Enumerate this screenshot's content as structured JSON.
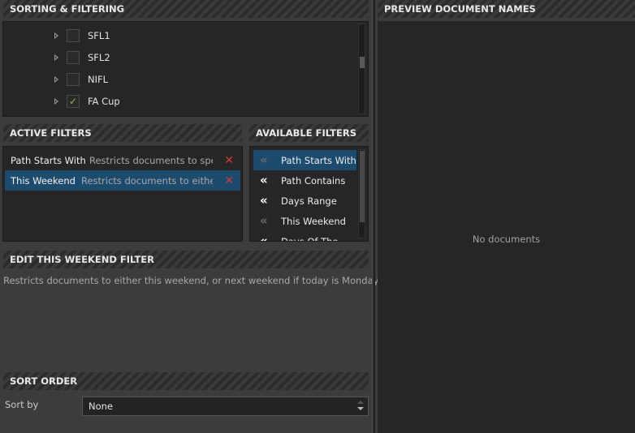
{
  "sorting_filtering": {
    "title": "SORTING & FILTERING",
    "tree_items": [
      {
        "label": "SFL1",
        "checked": false
      },
      {
        "label": "SFL2",
        "checked": false
      },
      {
        "label": "NIFL",
        "checked": false
      },
      {
        "label": "FA Cup",
        "checked": true
      }
    ],
    "check_glyph": "✓"
  },
  "active_filters": {
    "title": "ACTIVE FILTERS",
    "items": [
      {
        "name": "Path Starts With",
        "description": "Restricts documents to speci...",
        "selected": false,
        "remove_glyph": "✕"
      },
      {
        "name": "This Weekend",
        "description": "Restricts documents to either ...",
        "selected": true,
        "remove_glyph": "✕"
      }
    ]
  },
  "available_filters": {
    "title": "AVAILABLE FILTERS",
    "chevron_glyph": "«",
    "items": [
      {
        "label": "Path Starts With",
        "selected": true,
        "enabled": false
      },
      {
        "label": "Path Contains",
        "selected": false,
        "enabled": true
      },
      {
        "label": "Days Range",
        "selected": false,
        "enabled": true
      },
      {
        "label": "This Weekend",
        "selected": false,
        "enabled": false
      },
      {
        "label": "Days Of The",
        "selected": false,
        "enabled": true
      }
    ]
  },
  "edit_filter": {
    "title": "EDIT THIS WEEKEND FILTER",
    "description": "Restricts documents to either this weekend, or next weekend if today is Monday - Fr..."
  },
  "sort_order": {
    "title": "SORT ORDER",
    "sort_by_label": "Sort by",
    "sort_by_value": "None"
  },
  "preview": {
    "title": "PREVIEW DOCUMENT NAMES",
    "empty_message": "No documents"
  },
  "colors": {
    "selection": "#1c4b6e",
    "remove": "#d03838",
    "check": "#8bc34a"
  }
}
